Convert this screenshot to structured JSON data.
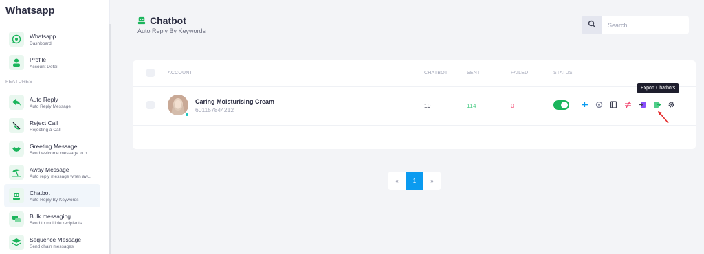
{
  "sidebar": {
    "brand": "Whatsapp",
    "items": [
      {
        "title": "Whatsapp",
        "sub": "Dashboard",
        "icon": "whatsapp-icon"
      },
      {
        "title": "Profile",
        "sub": "Account Detail",
        "icon": "user-icon"
      }
    ],
    "section_label": "FEATURES",
    "features": [
      {
        "title": "Auto Reply",
        "sub": "Auto Reply Message",
        "icon": "reply-icon"
      },
      {
        "title": "Reject Call",
        "sub": "Rejecting a Call",
        "icon": "phone-slash-icon"
      },
      {
        "title": "Greeting Message",
        "sub": "Send welcome message to n...",
        "icon": "handshake-icon"
      },
      {
        "title": "Away Message",
        "sub": "Auto reply message when aw...",
        "icon": "beach-icon"
      },
      {
        "title": "Chatbot",
        "sub": "Auto Reply By Keywords",
        "icon": "robot-icon",
        "active": true
      },
      {
        "title": "Bulk messaging",
        "sub": "Send to multiple recipients",
        "icon": "chat-bubbles-icon"
      },
      {
        "title": "Sequence Message",
        "sub": "Send chain messages",
        "icon": "layers-icon"
      }
    ]
  },
  "header": {
    "title": "Chatbot",
    "subtitle": "Auto Reply By Keywords",
    "search_placeholder": "Search"
  },
  "table": {
    "columns": {
      "account": "ACCOUNT",
      "chatbot": "CHATBOT",
      "sent": "SENT",
      "failed": "FAILED",
      "status": "STATUS"
    },
    "rows": [
      {
        "name": "Caring Moisturising Cream",
        "phone": "601157844212",
        "chatbot": "19",
        "sent": "114",
        "failed": "0",
        "status_on": true
      }
    ],
    "tooltip": "Export Chatbots"
  },
  "pagination": {
    "prev": "«",
    "current": "1",
    "next": "»"
  },
  "colors": {
    "accent_green": "#1bb55c",
    "sent_green": "#50cd89",
    "failed_red": "#f1416c",
    "page_blue": "#0b9bf0"
  }
}
